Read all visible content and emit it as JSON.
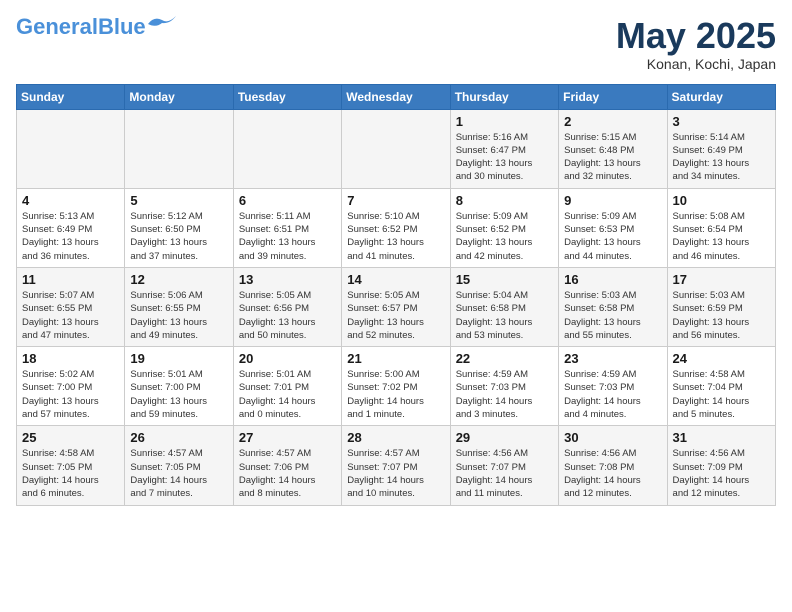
{
  "header": {
    "logo_general": "General",
    "logo_blue": "Blue",
    "month": "May 2025",
    "location": "Konan, Kochi, Japan"
  },
  "days_of_week": [
    "Sunday",
    "Monday",
    "Tuesday",
    "Wednesday",
    "Thursday",
    "Friday",
    "Saturday"
  ],
  "weeks": [
    {
      "days": [
        {
          "num": "",
          "info": ""
        },
        {
          "num": "",
          "info": ""
        },
        {
          "num": "",
          "info": ""
        },
        {
          "num": "",
          "info": ""
        },
        {
          "num": "1",
          "info": "Sunrise: 5:16 AM\nSunset: 6:47 PM\nDaylight: 13 hours\nand 30 minutes."
        },
        {
          "num": "2",
          "info": "Sunrise: 5:15 AM\nSunset: 6:48 PM\nDaylight: 13 hours\nand 32 minutes."
        },
        {
          "num": "3",
          "info": "Sunrise: 5:14 AM\nSunset: 6:49 PM\nDaylight: 13 hours\nand 34 minutes."
        }
      ]
    },
    {
      "days": [
        {
          "num": "4",
          "info": "Sunrise: 5:13 AM\nSunset: 6:49 PM\nDaylight: 13 hours\nand 36 minutes."
        },
        {
          "num": "5",
          "info": "Sunrise: 5:12 AM\nSunset: 6:50 PM\nDaylight: 13 hours\nand 37 minutes."
        },
        {
          "num": "6",
          "info": "Sunrise: 5:11 AM\nSunset: 6:51 PM\nDaylight: 13 hours\nand 39 minutes."
        },
        {
          "num": "7",
          "info": "Sunrise: 5:10 AM\nSunset: 6:52 PM\nDaylight: 13 hours\nand 41 minutes."
        },
        {
          "num": "8",
          "info": "Sunrise: 5:09 AM\nSunset: 6:52 PM\nDaylight: 13 hours\nand 42 minutes."
        },
        {
          "num": "9",
          "info": "Sunrise: 5:09 AM\nSunset: 6:53 PM\nDaylight: 13 hours\nand 44 minutes."
        },
        {
          "num": "10",
          "info": "Sunrise: 5:08 AM\nSunset: 6:54 PM\nDaylight: 13 hours\nand 46 minutes."
        }
      ]
    },
    {
      "days": [
        {
          "num": "11",
          "info": "Sunrise: 5:07 AM\nSunset: 6:55 PM\nDaylight: 13 hours\nand 47 minutes."
        },
        {
          "num": "12",
          "info": "Sunrise: 5:06 AM\nSunset: 6:55 PM\nDaylight: 13 hours\nand 49 minutes."
        },
        {
          "num": "13",
          "info": "Sunrise: 5:05 AM\nSunset: 6:56 PM\nDaylight: 13 hours\nand 50 minutes."
        },
        {
          "num": "14",
          "info": "Sunrise: 5:05 AM\nSunset: 6:57 PM\nDaylight: 13 hours\nand 52 minutes."
        },
        {
          "num": "15",
          "info": "Sunrise: 5:04 AM\nSunset: 6:58 PM\nDaylight: 13 hours\nand 53 minutes."
        },
        {
          "num": "16",
          "info": "Sunrise: 5:03 AM\nSunset: 6:58 PM\nDaylight: 13 hours\nand 55 minutes."
        },
        {
          "num": "17",
          "info": "Sunrise: 5:03 AM\nSunset: 6:59 PM\nDaylight: 13 hours\nand 56 minutes."
        }
      ]
    },
    {
      "days": [
        {
          "num": "18",
          "info": "Sunrise: 5:02 AM\nSunset: 7:00 PM\nDaylight: 13 hours\nand 57 minutes."
        },
        {
          "num": "19",
          "info": "Sunrise: 5:01 AM\nSunset: 7:00 PM\nDaylight: 13 hours\nand 59 minutes."
        },
        {
          "num": "20",
          "info": "Sunrise: 5:01 AM\nSunset: 7:01 PM\nDaylight: 14 hours\nand 0 minutes."
        },
        {
          "num": "21",
          "info": "Sunrise: 5:00 AM\nSunset: 7:02 PM\nDaylight: 14 hours\nand 1 minute."
        },
        {
          "num": "22",
          "info": "Sunrise: 4:59 AM\nSunset: 7:03 PM\nDaylight: 14 hours\nand 3 minutes."
        },
        {
          "num": "23",
          "info": "Sunrise: 4:59 AM\nSunset: 7:03 PM\nDaylight: 14 hours\nand 4 minutes."
        },
        {
          "num": "24",
          "info": "Sunrise: 4:58 AM\nSunset: 7:04 PM\nDaylight: 14 hours\nand 5 minutes."
        }
      ]
    },
    {
      "days": [
        {
          "num": "25",
          "info": "Sunrise: 4:58 AM\nSunset: 7:05 PM\nDaylight: 14 hours\nand 6 minutes."
        },
        {
          "num": "26",
          "info": "Sunrise: 4:57 AM\nSunset: 7:05 PM\nDaylight: 14 hours\nand 7 minutes."
        },
        {
          "num": "27",
          "info": "Sunrise: 4:57 AM\nSunset: 7:06 PM\nDaylight: 14 hours\nand 8 minutes."
        },
        {
          "num": "28",
          "info": "Sunrise: 4:57 AM\nSunset: 7:07 PM\nDaylight: 14 hours\nand 10 minutes."
        },
        {
          "num": "29",
          "info": "Sunrise: 4:56 AM\nSunset: 7:07 PM\nDaylight: 14 hours\nand 11 minutes."
        },
        {
          "num": "30",
          "info": "Sunrise: 4:56 AM\nSunset: 7:08 PM\nDaylight: 14 hours\nand 12 minutes."
        },
        {
          "num": "31",
          "info": "Sunrise: 4:56 AM\nSunset: 7:09 PM\nDaylight: 14 hours\nand 12 minutes."
        }
      ]
    }
  ]
}
